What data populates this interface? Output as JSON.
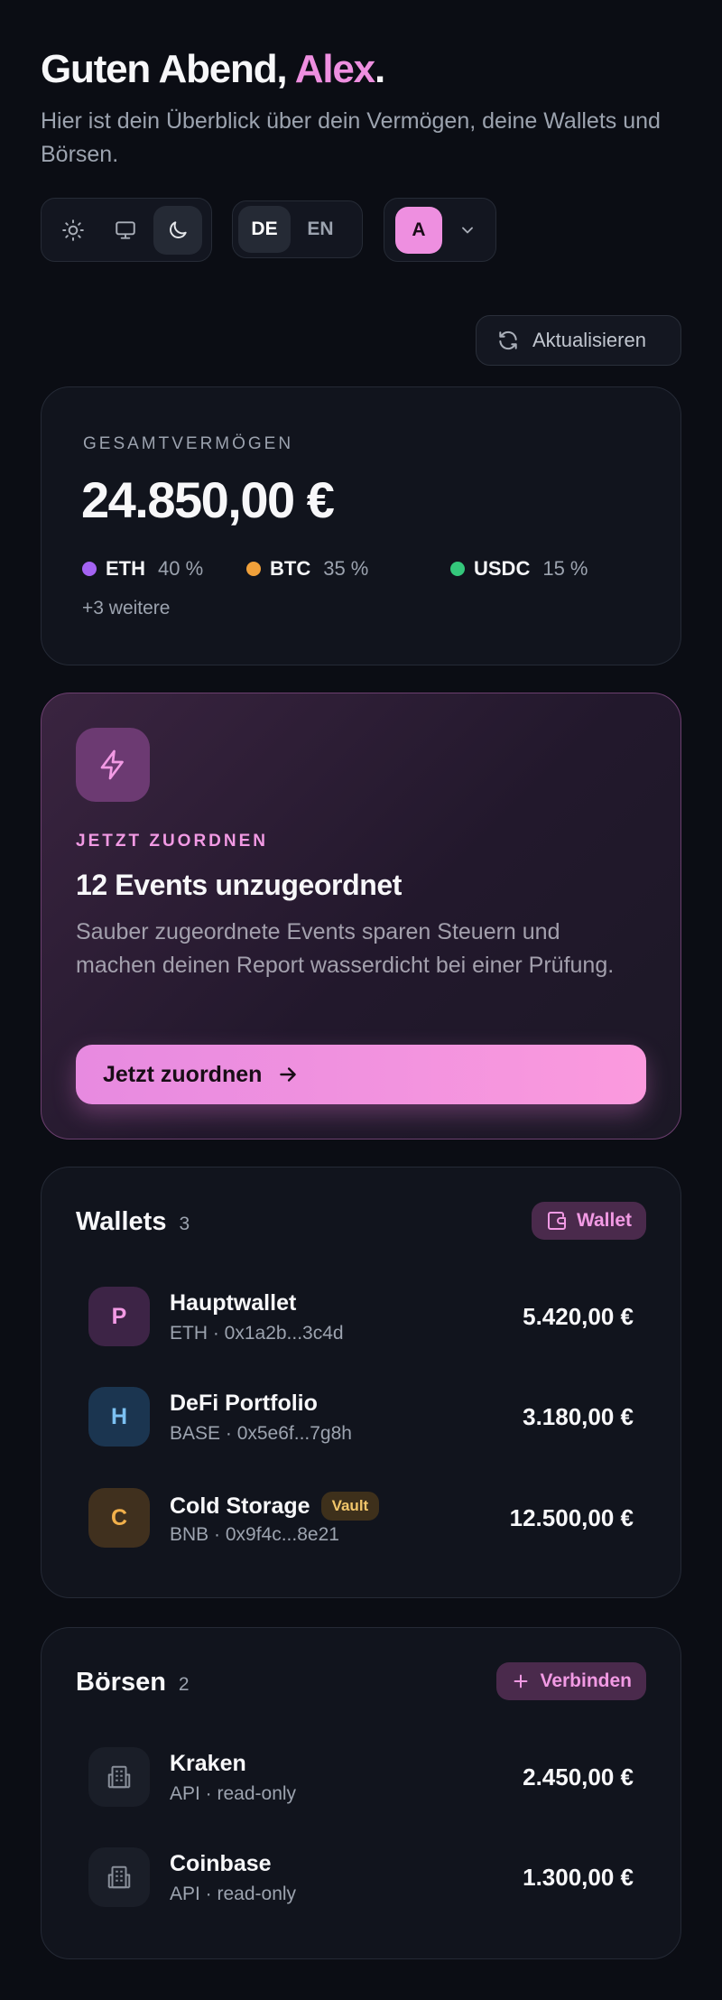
{
  "greeting": {
    "prefix": "Guten Abend, ",
    "name": "Alex",
    "suffix": "."
  },
  "subtitle": "Hier ist dein Überblick über dein Vermögen, deine Wallets und Börsen.",
  "theme_switch": {
    "icons": [
      "sun-icon",
      "monitor-icon",
      "moon-icon"
    ],
    "active": "moon-icon"
  },
  "language": {
    "options": [
      "DE",
      "EN"
    ],
    "active": "DE"
  },
  "user_menu": {
    "avatar_initial": "A",
    "icon": "chevron-down-icon"
  },
  "refresh_label": "Aktualisieren",
  "portfolio": {
    "label": "GESAMTVERMÖGEN",
    "total": "24.850,00 €",
    "allocations": [
      {
        "symbol": "ETH",
        "percent": "40 %",
        "color": "#a463f2"
      },
      {
        "symbol": "BTC",
        "percent": "35 %",
        "color": "#f0a03a"
      },
      {
        "symbol": "USDC",
        "percent": "15 %",
        "color": "#34c77b"
      }
    ],
    "more": "+3 weitere"
  },
  "promo": {
    "icon": "lightning-icon",
    "kicker": "JETZT ZUORDNEN",
    "title": "12 Events unzugeordnet",
    "description": "Sauber zugeordnete Events sparen Steuern und machen deinen Report wasserdicht bei einer Prüfung.",
    "cta_label": "Jetzt zuordnen"
  },
  "wallets": {
    "title": "Wallets",
    "count": "3",
    "action_label": "Wallet",
    "items": [
      {
        "initial": "P",
        "name": "Hauptwallet",
        "detail": "ETH · 0x1a2b...3c4d",
        "amount": "5.420,00 €",
        "badge": "",
        "bg": "#3d2446",
        "fg": "#f29ae4"
      },
      {
        "initial": "H",
        "name": "DeFi Portfolio",
        "detail": "BASE · 0x5e6f...7g8h",
        "amount": "3.180,00 €",
        "badge": "",
        "bg": "#1b3550",
        "fg": "#7cc1f2"
      },
      {
        "initial": "C",
        "name": "Cold Storage",
        "detail": "BNB · 0x9f4c...8e21",
        "amount": "12.500,00 €",
        "badge": "Vault",
        "bg": "#40301e",
        "fg": "#f2b04b"
      }
    ]
  },
  "exchanges": {
    "title": "Börsen",
    "count": "2",
    "action_label": "Verbinden",
    "items": [
      {
        "name": "Kraken",
        "detail": "API · read-only",
        "amount": "2.450,00 €",
        "icon": "building-icon"
      },
      {
        "name": "Coinbase",
        "detail": "API · read-only",
        "amount": "1.300,00 €",
        "icon": "building-icon"
      }
    ]
  }
}
